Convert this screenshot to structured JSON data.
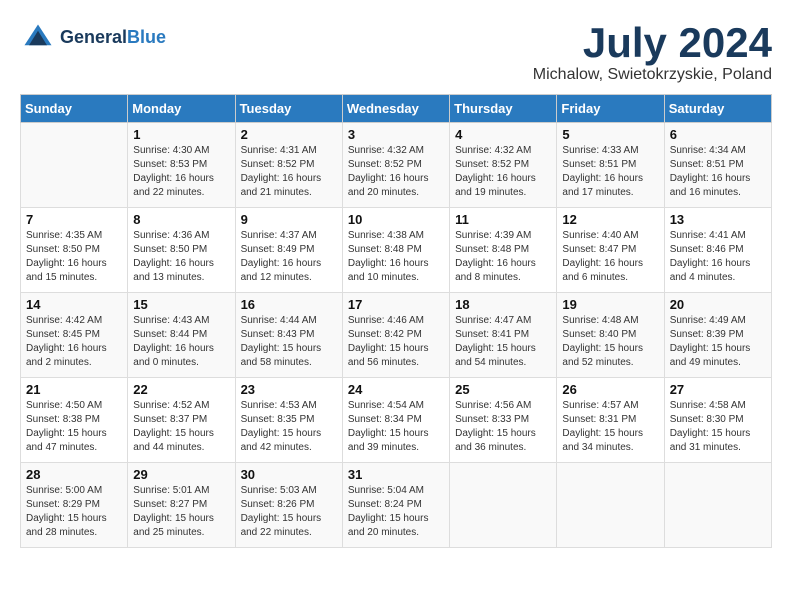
{
  "header": {
    "logo_line1": "General",
    "logo_line2": "Blue",
    "month": "July 2024",
    "location": "Michalow, Swietokrzyskie, Poland"
  },
  "weekdays": [
    "Sunday",
    "Monday",
    "Tuesday",
    "Wednesday",
    "Thursday",
    "Friday",
    "Saturday"
  ],
  "weeks": [
    [
      {
        "day": "",
        "sunrise": "",
        "sunset": "",
        "daylight": ""
      },
      {
        "day": "1",
        "sunrise": "Sunrise: 4:30 AM",
        "sunset": "Sunset: 8:53 PM",
        "daylight": "Daylight: 16 hours and 22 minutes."
      },
      {
        "day": "2",
        "sunrise": "Sunrise: 4:31 AM",
        "sunset": "Sunset: 8:52 PM",
        "daylight": "Daylight: 16 hours and 21 minutes."
      },
      {
        "day": "3",
        "sunrise": "Sunrise: 4:32 AM",
        "sunset": "Sunset: 8:52 PM",
        "daylight": "Daylight: 16 hours and 20 minutes."
      },
      {
        "day": "4",
        "sunrise": "Sunrise: 4:32 AM",
        "sunset": "Sunset: 8:52 PM",
        "daylight": "Daylight: 16 hours and 19 minutes."
      },
      {
        "day": "5",
        "sunrise": "Sunrise: 4:33 AM",
        "sunset": "Sunset: 8:51 PM",
        "daylight": "Daylight: 16 hours and 17 minutes."
      },
      {
        "day": "6",
        "sunrise": "Sunrise: 4:34 AM",
        "sunset": "Sunset: 8:51 PM",
        "daylight": "Daylight: 16 hours and 16 minutes."
      }
    ],
    [
      {
        "day": "7",
        "sunrise": "Sunrise: 4:35 AM",
        "sunset": "Sunset: 8:50 PM",
        "daylight": "Daylight: 16 hours and 15 minutes."
      },
      {
        "day": "8",
        "sunrise": "Sunrise: 4:36 AM",
        "sunset": "Sunset: 8:50 PM",
        "daylight": "Daylight: 16 hours and 13 minutes."
      },
      {
        "day": "9",
        "sunrise": "Sunrise: 4:37 AM",
        "sunset": "Sunset: 8:49 PM",
        "daylight": "Daylight: 16 hours and 12 minutes."
      },
      {
        "day": "10",
        "sunrise": "Sunrise: 4:38 AM",
        "sunset": "Sunset: 8:48 PM",
        "daylight": "Daylight: 16 hours and 10 minutes."
      },
      {
        "day": "11",
        "sunrise": "Sunrise: 4:39 AM",
        "sunset": "Sunset: 8:48 PM",
        "daylight": "Daylight: 16 hours and 8 minutes."
      },
      {
        "day": "12",
        "sunrise": "Sunrise: 4:40 AM",
        "sunset": "Sunset: 8:47 PM",
        "daylight": "Daylight: 16 hours and 6 minutes."
      },
      {
        "day": "13",
        "sunrise": "Sunrise: 4:41 AM",
        "sunset": "Sunset: 8:46 PM",
        "daylight": "Daylight: 16 hours and 4 minutes."
      }
    ],
    [
      {
        "day": "14",
        "sunrise": "Sunrise: 4:42 AM",
        "sunset": "Sunset: 8:45 PM",
        "daylight": "Daylight: 16 hours and 2 minutes."
      },
      {
        "day": "15",
        "sunrise": "Sunrise: 4:43 AM",
        "sunset": "Sunset: 8:44 PM",
        "daylight": "Daylight: 16 hours and 0 minutes."
      },
      {
        "day": "16",
        "sunrise": "Sunrise: 4:44 AM",
        "sunset": "Sunset: 8:43 PM",
        "daylight": "Daylight: 15 hours and 58 minutes."
      },
      {
        "day": "17",
        "sunrise": "Sunrise: 4:46 AM",
        "sunset": "Sunset: 8:42 PM",
        "daylight": "Daylight: 15 hours and 56 minutes."
      },
      {
        "day": "18",
        "sunrise": "Sunrise: 4:47 AM",
        "sunset": "Sunset: 8:41 PM",
        "daylight": "Daylight: 15 hours and 54 minutes."
      },
      {
        "day": "19",
        "sunrise": "Sunrise: 4:48 AM",
        "sunset": "Sunset: 8:40 PM",
        "daylight": "Daylight: 15 hours and 52 minutes."
      },
      {
        "day": "20",
        "sunrise": "Sunrise: 4:49 AM",
        "sunset": "Sunset: 8:39 PM",
        "daylight": "Daylight: 15 hours and 49 minutes."
      }
    ],
    [
      {
        "day": "21",
        "sunrise": "Sunrise: 4:50 AM",
        "sunset": "Sunset: 8:38 PM",
        "daylight": "Daylight: 15 hours and 47 minutes."
      },
      {
        "day": "22",
        "sunrise": "Sunrise: 4:52 AM",
        "sunset": "Sunset: 8:37 PM",
        "daylight": "Daylight: 15 hours and 44 minutes."
      },
      {
        "day": "23",
        "sunrise": "Sunrise: 4:53 AM",
        "sunset": "Sunset: 8:35 PM",
        "daylight": "Daylight: 15 hours and 42 minutes."
      },
      {
        "day": "24",
        "sunrise": "Sunrise: 4:54 AM",
        "sunset": "Sunset: 8:34 PM",
        "daylight": "Daylight: 15 hours and 39 minutes."
      },
      {
        "day": "25",
        "sunrise": "Sunrise: 4:56 AM",
        "sunset": "Sunset: 8:33 PM",
        "daylight": "Daylight: 15 hours and 36 minutes."
      },
      {
        "day": "26",
        "sunrise": "Sunrise: 4:57 AM",
        "sunset": "Sunset: 8:31 PM",
        "daylight": "Daylight: 15 hours and 34 minutes."
      },
      {
        "day": "27",
        "sunrise": "Sunrise: 4:58 AM",
        "sunset": "Sunset: 8:30 PM",
        "daylight": "Daylight: 15 hours and 31 minutes."
      }
    ],
    [
      {
        "day": "28",
        "sunrise": "Sunrise: 5:00 AM",
        "sunset": "Sunset: 8:29 PM",
        "daylight": "Daylight: 15 hours and 28 minutes."
      },
      {
        "day": "29",
        "sunrise": "Sunrise: 5:01 AM",
        "sunset": "Sunset: 8:27 PM",
        "daylight": "Daylight: 15 hours and 25 minutes."
      },
      {
        "day": "30",
        "sunrise": "Sunrise: 5:03 AM",
        "sunset": "Sunset: 8:26 PM",
        "daylight": "Daylight: 15 hours and 22 minutes."
      },
      {
        "day": "31",
        "sunrise": "Sunrise: 5:04 AM",
        "sunset": "Sunset: 8:24 PM",
        "daylight": "Daylight: 15 hours and 20 minutes."
      },
      {
        "day": "",
        "sunrise": "",
        "sunset": "",
        "daylight": ""
      },
      {
        "day": "",
        "sunrise": "",
        "sunset": "",
        "daylight": ""
      },
      {
        "day": "",
        "sunrise": "",
        "sunset": "",
        "daylight": ""
      }
    ]
  ]
}
